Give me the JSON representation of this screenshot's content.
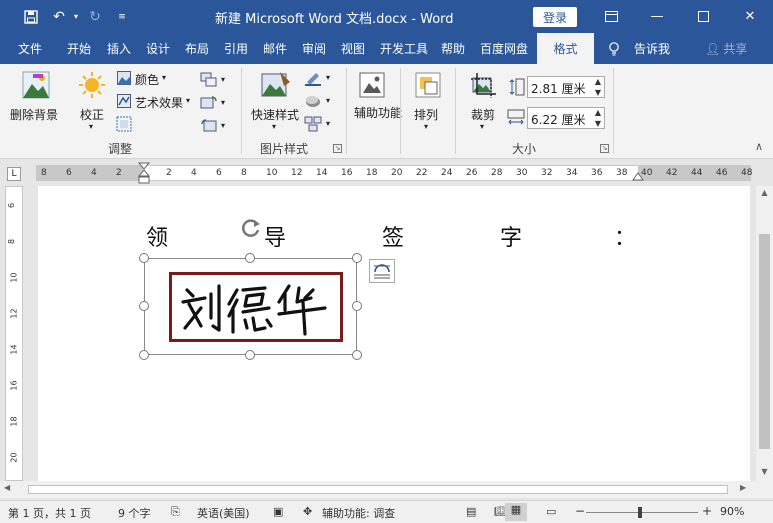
{
  "titlebar": {
    "title": "新建 Microsoft Word 文档.docx - Word",
    "login": "登录"
  },
  "tabs": [
    "文件",
    "开始",
    "插入",
    "设计",
    "布局",
    "引用",
    "邮件",
    "审阅",
    "视图",
    "开发工具",
    "帮助",
    "百度网盘",
    "格式"
  ],
  "active_tab": "格式",
  "tell_me": "告诉我",
  "share": "共享",
  "ribbon": {
    "remove_bg": "删除背景",
    "correct": "校正",
    "color": "颜色",
    "artistic": "艺术效果",
    "group_adjust": "调整",
    "quick_styles": "快速样式",
    "group_picstyle": "图片样式",
    "accessibility": "辅助功能",
    "arrange": "排列",
    "crop": "裁剪",
    "height": "2.81 厘米",
    "width": "6.22 厘米",
    "group_size": "大小"
  },
  "ruler_h": [
    "8",
    "6",
    "4",
    "2",
    "2",
    "4",
    "6",
    "8",
    "10",
    "12",
    "14",
    "16",
    "18",
    "20",
    "22",
    "24",
    "26",
    "28",
    "30",
    "32",
    "34",
    "36",
    "38",
    "40",
    "42",
    "44",
    "46",
    "48"
  ],
  "ruler_v": [
    "6",
    "8",
    "10",
    "12",
    "14",
    "16",
    "18",
    "20"
  ],
  "document": {
    "sign_line": [
      "领",
      "导",
      "签",
      "字",
      "："
    ]
  },
  "status": {
    "page": "第 1 页，共 1 页",
    "words": "9 个字",
    "lang": "英语(美国)",
    "a11y": "辅助功能: 调查",
    "zoom": "90%"
  },
  "colors": {
    "brand": "#2b579a",
    "frame": "#7b1a1a"
  }
}
